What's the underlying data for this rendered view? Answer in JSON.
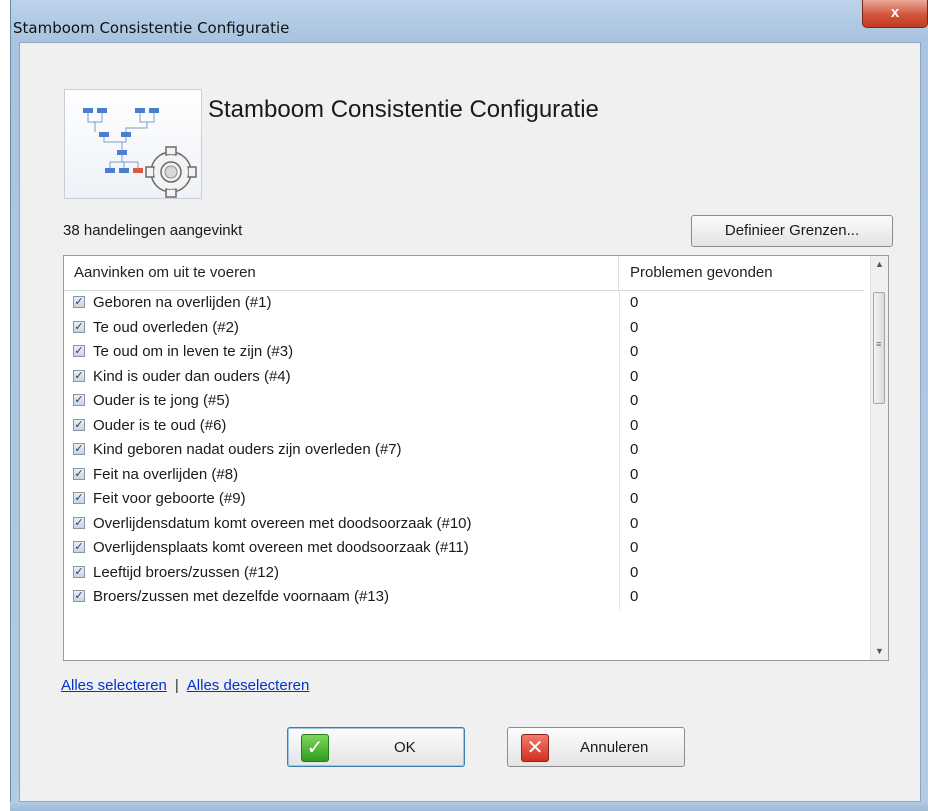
{
  "window": {
    "title": "Stamboom Consistentie Configuratie",
    "close_label": "x"
  },
  "header": {
    "heading": "Stamboom Consistentie Configuratie",
    "logo_icon": "family-tree-gear-icon"
  },
  "summary": {
    "checked_count_label": "38 handelingen aangevinkt",
    "define_limits_button": "Definieer Grenzen..."
  },
  "table": {
    "columns": [
      "Aanvinken om uit te voeren",
      "Problemen gevonden"
    ],
    "rows": [
      {
        "label": "Geboren na overlijden (#1)",
        "problems": "0",
        "checked": true
      },
      {
        "label": "Te oud overleden (#2)",
        "problems": "0",
        "checked": true
      },
      {
        "label": "Te oud om in leven te zijn (#3)",
        "problems": "0",
        "checked": true
      },
      {
        "label": "Kind is ouder dan ouders (#4)",
        "problems": "0",
        "checked": true
      },
      {
        "label": "Ouder is te jong (#5)",
        "problems": "0",
        "checked": true
      },
      {
        "label": "Ouder is te oud (#6)",
        "problems": "0",
        "checked": true
      },
      {
        "label": "Kind geboren nadat ouders zijn overleden (#7)",
        "problems": "0",
        "checked": true
      },
      {
        "label": "Feit na overlijden (#8)",
        "problems": "0",
        "checked": true
      },
      {
        "label": "Feit voor geboorte (#9)",
        "problems": "0",
        "checked": true
      },
      {
        "label": "Overlijdensdatum komt overeen met doodsoorzaak (#10)",
        "problems": "0",
        "checked": true
      },
      {
        "label": "Overlijdensplaats komt overeen met doodsoorzaak (#11)",
        "problems": "0",
        "checked": true
      },
      {
        "label": "Leeftijd broers/zussen (#12)",
        "problems": "0",
        "checked": true
      },
      {
        "label": "Broers/zussen met dezelfde voornaam (#13)",
        "problems": "0",
        "checked": true
      }
    ]
  },
  "links": {
    "select_all": "Alles selecteren",
    "separator": "|",
    "deselect_all": "Alles deselecteren"
  },
  "buttons": {
    "ok": "OK",
    "cancel": "Annuleren"
  }
}
